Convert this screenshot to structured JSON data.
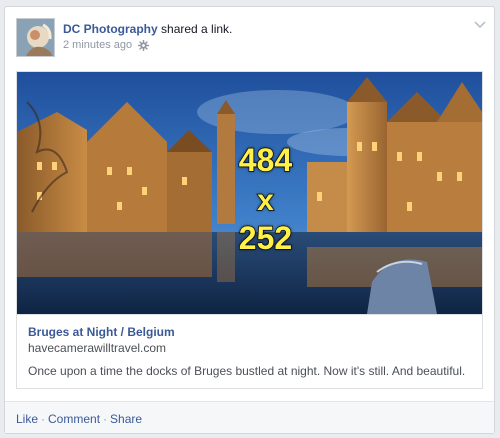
{
  "post": {
    "page_name": "DC Photography",
    "action_text": "shared a link.",
    "timestamp": "2 minutes ago",
    "privacy_icon": "gear-icon",
    "menu_icon": "chevron-down-icon"
  },
  "link": {
    "title": "Bruges at Night / Belgium",
    "domain": "havecamerawilltravel.com",
    "description": "Once upon a time the docks of Bruges bustled at night. Now it's still. And beautiful.",
    "image_size_label": {
      "width": "484",
      "by": "x",
      "height": "252"
    }
  },
  "actions": {
    "like": "Like",
    "comment": "Comment",
    "share": "Share",
    "separator": "·"
  },
  "colors": {
    "link_blue": "#3b5998",
    "overlay_yellow": "#fff14a",
    "meta_gray": "#9197a3"
  }
}
